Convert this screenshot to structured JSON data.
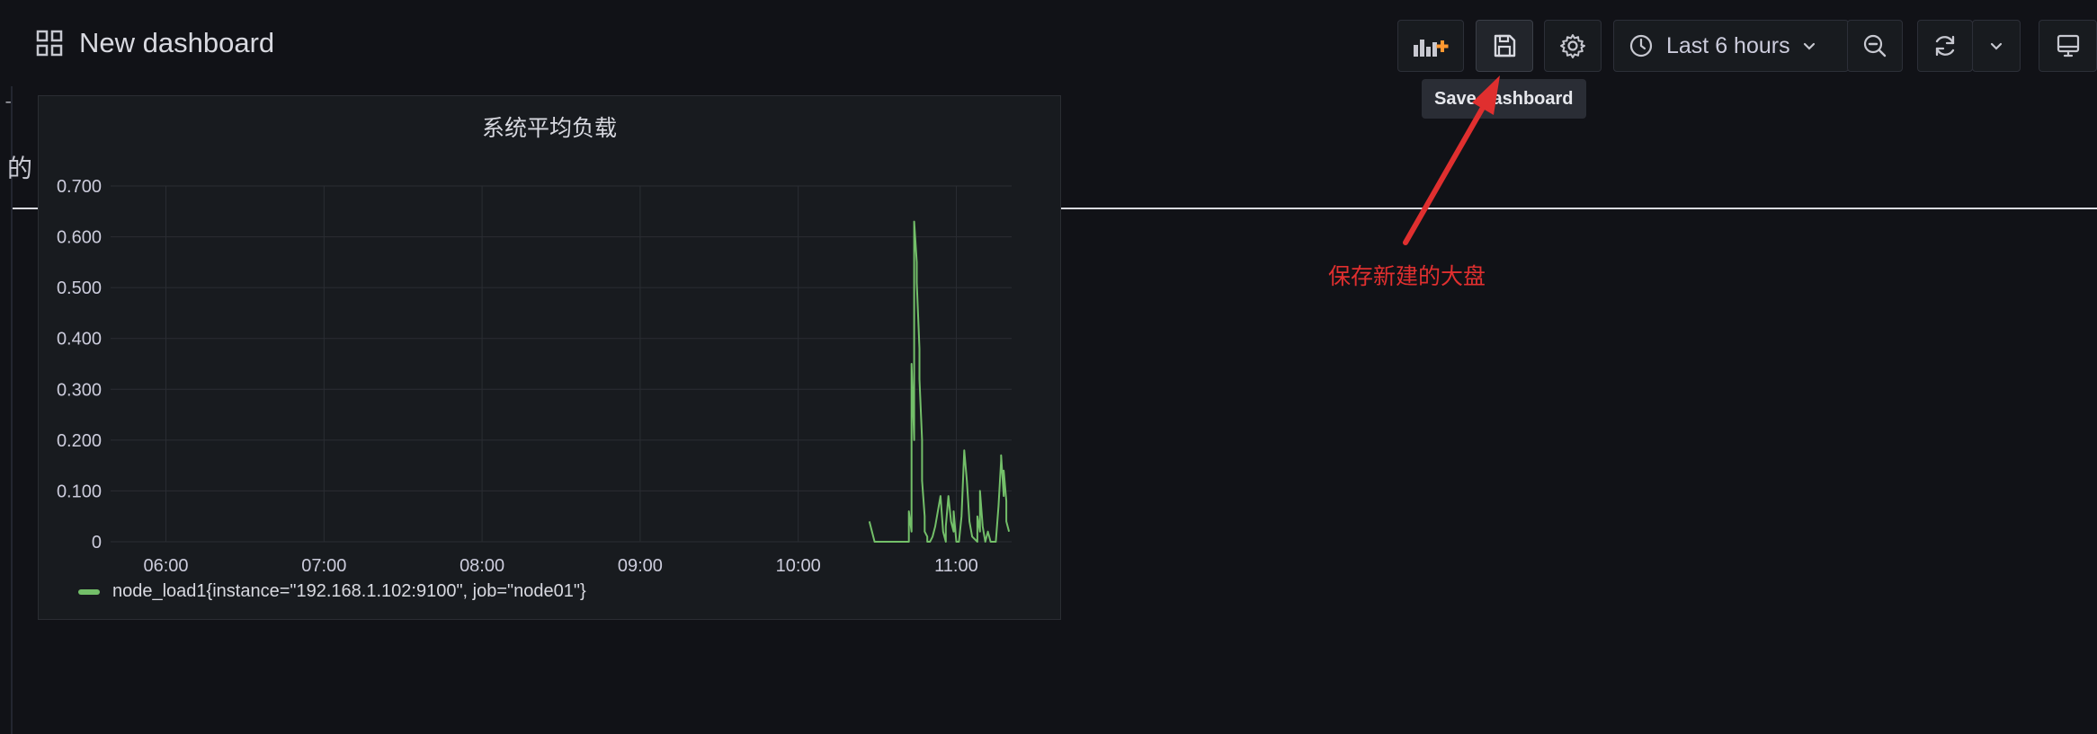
{
  "dashboard": {
    "title": "New dashboard"
  },
  "toolbar": {
    "time_range_label": "Last 6 hours",
    "save_tooltip": "Save dashboard"
  },
  "background_fragments": {
    "frag1": "ˉ",
    "frag2": "的"
  },
  "annotation": {
    "text": "保存新建的大盘",
    "color": "#e02f2f"
  },
  "panel": {
    "title": "系统平均负载",
    "legend": "node_load1{instance=\"192.168.1.102:9100\", job=\"node01\"}"
  },
  "colors": {
    "series": "#73bf69",
    "background": "#111217",
    "panel": "#181b1f",
    "accent": "#ff9830"
  },
  "chart_data": {
    "type": "line",
    "title": "系统平均负载",
    "xlabel": "",
    "ylabel": "",
    "x_ticks": [
      "06:00",
      "07:00",
      "08:00",
      "09:00",
      "10:00",
      "11:00"
    ],
    "y_ticks": [
      "0",
      "0.100",
      "0.200",
      "0.300",
      "0.400",
      "0.500",
      "0.600",
      "0.700"
    ],
    "xlim": [
      "05:39",
      "11:21"
    ],
    "ylim": [
      0,
      0.7
    ],
    "grid": true,
    "legend_position": "bottom-left",
    "series": [
      {
        "name": "node_load1{instance=\"192.168.1.102:9100\", job=\"node01\"}",
        "color": "#73bf69",
        "x": [
          "10:27",
          "10:28",
          "10:29",
          "10:33",
          "10:36",
          "10:42",
          "10:42",
          "10:43",
          "10:43",
          "10:44",
          "10:44",
          "10:45",
          "10:45",
          "10:46",
          "10:46",
          "10:47",
          "10:47",
          "10:48",
          "10:48",
          "10:49",
          "10:49",
          "10:50",
          "10:51",
          "10:52",
          "10:54",
          "10:55",
          "10:56",
          "10:56",
          "10:57",
          "10:58",
          "10:59",
          "10:59",
          "11:00",
          "11:01",
          "11:02",
          "11:03",
          "11:04",
          "11:05",
          "11:06",
          "11:08",
          "11:08",
          "11:09",
          "11:09",
          "11:10",
          "11:11",
          "11:12",
          "11:13",
          "11:14",
          "11:15",
          "11:16",
          "11:17",
          "11:17",
          "11:18",
          "11:18",
          "11:19",
          "11:19",
          "11:20"
        ],
        "y": [
          0.04,
          0.02,
          0,
          0,
          0,
          0,
          0.06,
          0.02,
          0.35,
          0.2,
          0.63,
          0.55,
          0.51,
          0.38,
          0.32,
          0.2,
          0.12,
          0.05,
          0.02,
          0.01,
          0,
          0,
          0.01,
          0.03,
          0.09,
          0.02,
          0,
          0.03,
          0.09,
          0.04,
          0.02,
          0.06,
          0,
          0,
          0.05,
          0.18,
          0.12,
          0.04,
          0.01,
          0,
          0.05,
          0.02,
          0.1,
          0.03,
          0,
          0.02,
          0,
          0,
          0,
          0.07,
          0.16,
          0.17,
          0.09,
          0.14,
          0.08,
          0.04,
          0.02
        ]
      }
    ]
  }
}
